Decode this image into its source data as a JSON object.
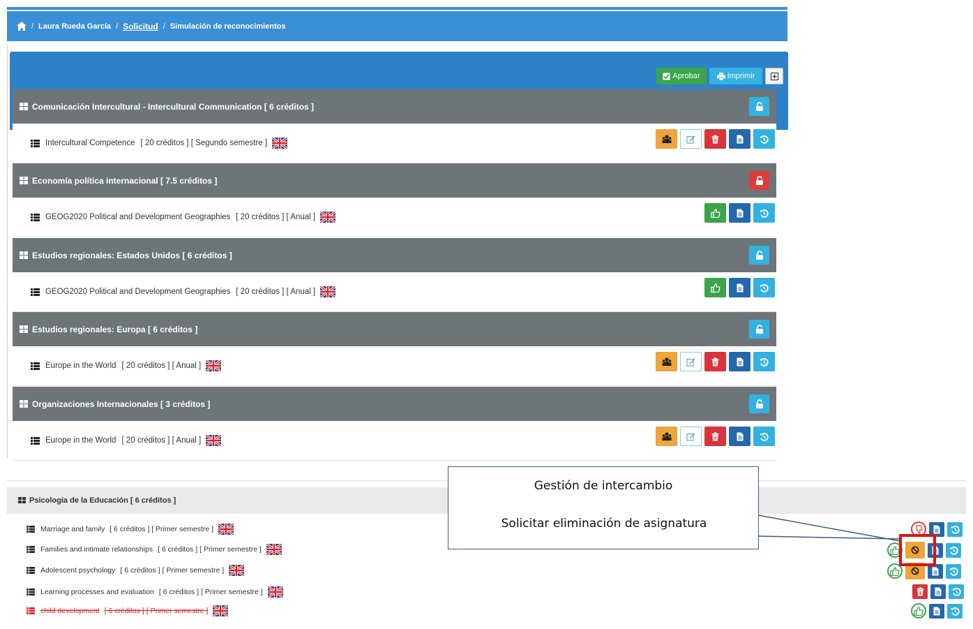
{
  "breadcrumb": {
    "name": "Laura Rueda García",
    "solicitud": "Solicitud",
    "current": "Simulación de reconocimientos",
    "separator": "/"
  },
  "toolbar": {
    "approve_label": "Aprobar",
    "print_label": "Imprimir"
  },
  "groups": [
    {
      "title": "Comunicación Intercultural - Intercultural Communication [ 6 créditos ]",
      "lock_color": "#33b1e0",
      "course": {
        "name": "Intercultural Competence",
        "meta": "[ 20 créditos ]   [ Segundo semestre ]"
      }
    },
    {
      "title": "Economía política internacional [ 7.5 créditos ]",
      "lock_color": "#dc3d3d",
      "course": {
        "name": "GEOG2020 Political and Development Geographies",
        "meta": "[ 20 créditos ]   [ Anual ]"
      }
    },
    {
      "title": "Estudios regionales: Estados Unidos [ 6 créditos ]",
      "lock_color": "#33b1e0",
      "course": {
        "name": "GEOG2020 Political and Development Geographies",
        "meta": "[ 20 créditos ]   [ Anual ]"
      }
    },
    {
      "title": "Estudios regionales: Europa [ 6 créditos ]",
      "lock_color": "#33b1e0",
      "course": {
        "name": "Europe in the World",
        "meta": "[ 20 créditos ]   [ Anual ]"
      }
    },
    {
      "title": "Organizaciones Internacionales [ 3 créditos ]",
      "lock_color": "#33b1e0",
      "course": {
        "name": "Europe in the World",
        "meta": "[ 20 créditos ]   [ Anual ]"
      }
    }
  ],
  "lower": {
    "header": "Psicología de la Educación [ 6 créditos ]",
    "rows": [
      {
        "name": "Marriage and family",
        "meta": "[ 6 créditos ]   [ Primer semestre ]"
      },
      {
        "name": "Families and intimate relationships",
        "meta": "[ 6 créditos ]   [ Primer semestre ]"
      },
      {
        "name": "Adolescent psychology",
        "meta": "[ 6 créditos ]   [ Primer semestre ]"
      },
      {
        "name": "Learning processes and evaluation",
        "meta": "[ 6 créditos ]   [ Primer semestre ]"
      },
      {
        "name": "child development",
        "meta": "[ 6 créditos ]   [ Primer semestre ]"
      }
    ]
  },
  "callout": {
    "title": "Gestión de intercambio",
    "subtitle": "Solicitar eliminación de asignatura"
  },
  "icons": [
    "home-icon",
    "check-square-icon",
    "print-icon",
    "plus-square-icon",
    "grid-icon",
    "list-icon",
    "lock-icon",
    "unlock-icon",
    "uk-flag-icon",
    "users-icon",
    "edit-icon",
    "trash-icon",
    "document-icon",
    "history-icon",
    "thumbs-up-icon",
    "thumbs-down-icon",
    "ban-icon"
  ],
  "colors": {
    "primary": "#3b8fd6",
    "group_header": "#6d7579",
    "orange": "#f0a43a",
    "red": "#d9343b",
    "navy": "#2467ab",
    "cyan": "#33b1e0",
    "green": "#3aa54a"
  }
}
